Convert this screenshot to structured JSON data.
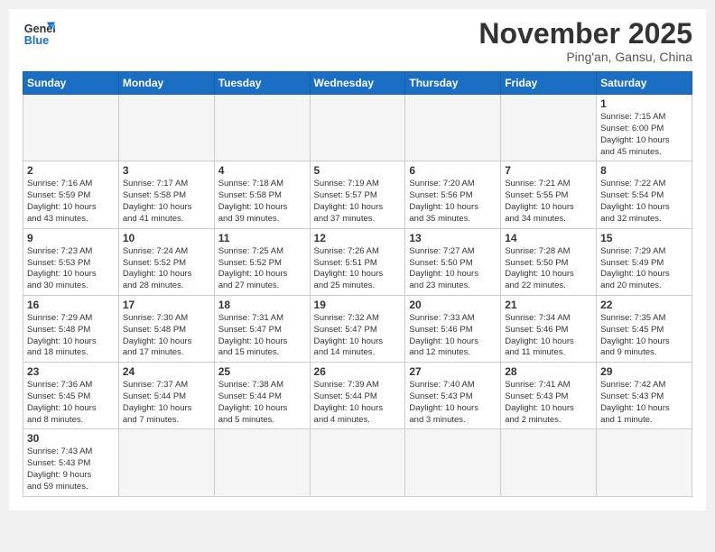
{
  "header": {
    "logo_line1": "General",
    "logo_line2": "Blue",
    "month_title": "November 2025",
    "location": "Ping'an, Gansu, China"
  },
  "weekdays": [
    "Sunday",
    "Monday",
    "Tuesday",
    "Wednesday",
    "Thursday",
    "Friday",
    "Saturday"
  ],
  "weeks": [
    [
      {
        "day": "",
        "info": ""
      },
      {
        "day": "",
        "info": ""
      },
      {
        "day": "",
        "info": ""
      },
      {
        "day": "",
        "info": ""
      },
      {
        "day": "",
        "info": ""
      },
      {
        "day": "",
        "info": ""
      },
      {
        "day": "1",
        "info": "Sunrise: 7:15 AM\nSunset: 6:00 PM\nDaylight: 10 hours\nand 45 minutes."
      }
    ],
    [
      {
        "day": "2",
        "info": "Sunrise: 7:16 AM\nSunset: 5:59 PM\nDaylight: 10 hours\nand 43 minutes."
      },
      {
        "day": "3",
        "info": "Sunrise: 7:17 AM\nSunset: 5:58 PM\nDaylight: 10 hours\nand 41 minutes."
      },
      {
        "day": "4",
        "info": "Sunrise: 7:18 AM\nSunset: 5:58 PM\nDaylight: 10 hours\nand 39 minutes."
      },
      {
        "day": "5",
        "info": "Sunrise: 7:19 AM\nSunset: 5:57 PM\nDaylight: 10 hours\nand 37 minutes."
      },
      {
        "day": "6",
        "info": "Sunrise: 7:20 AM\nSunset: 5:56 PM\nDaylight: 10 hours\nand 35 minutes."
      },
      {
        "day": "7",
        "info": "Sunrise: 7:21 AM\nSunset: 5:55 PM\nDaylight: 10 hours\nand 34 minutes."
      },
      {
        "day": "8",
        "info": "Sunrise: 7:22 AM\nSunset: 5:54 PM\nDaylight: 10 hours\nand 32 minutes."
      }
    ],
    [
      {
        "day": "9",
        "info": "Sunrise: 7:23 AM\nSunset: 5:53 PM\nDaylight: 10 hours\nand 30 minutes."
      },
      {
        "day": "10",
        "info": "Sunrise: 7:24 AM\nSunset: 5:52 PM\nDaylight: 10 hours\nand 28 minutes."
      },
      {
        "day": "11",
        "info": "Sunrise: 7:25 AM\nSunset: 5:52 PM\nDaylight: 10 hours\nand 27 minutes."
      },
      {
        "day": "12",
        "info": "Sunrise: 7:26 AM\nSunset: 5:51 PM\nDaylight: 10 hours\nand 25 minutes."
      },
      {
        "day": "13",
        "info": "Sunrise: 7:27 AM\nSunset: 5:50 PM\nDaylight: 10 hours\nand 23 minutes."
      },
      {
        "day": "14",
        "info": "Sunrise: 7:28 AM\nSunset: 5:50 PM\nDaylight: 10 hours\nand 22 minutes."
      },
      {
        "day": "15",
        "info": "Sunrise: 7:29 AM\nSunset: 5:49 PM\nDaylight: 10 hours\nand 20 minutes."
      }
    ],
    [
      {
        "day": "16",
        "info": "Sunrise: 7:29 AM\nSunset: 5:48 PM\nDaylight: 10 hours\nand 18 minutes."
      },
      {
        "day": "17",
        "info": "Sunrise: 7:30 AM\nSunset: 5:48 PM\nDaylight: 10 hours\nand 17 minutes."
      },
      {
        "day": "18",
        "info": "Sunrise: 7:31 AM\nSunset: 5:47 PM\nDaylight: 10 hours\nand 15 minutes."
      },
      {
        "day": "19",
        "info": "Sunrise: 7:32 AM\nSunset: 5:47 PM\nDaylight: 10 hours\nand 14 minutes."
      },
      {
        "day": "20",
        "info": "Sunrise: 7:33 AM\nSunset: 5:46 PM\nDaylight: 10 hours\nand 12 minutes."
      },
      {
        "day": "21",
        "info": "Sunrise: 7:34 AM\nSunset: 5:46 PM\nDaylight: 10 hours\nand 11 minutes."
      },
      {
        "day": "22",
        "info": "Sunrise: 7:35 AM\nSunset: 5:45 PM\nDaylight: 10 hours\nand 9 minutes."
      }
    ],
    [
      {
        "day": "23",
        "info": "Sunrise: 7:36 AM\nSunset: 5:45 PM\nDaylight: 10 hours\nand 8 minutes."
      },
      {
        "day": "24",
        "info": "Sunrise: 7:37 AM\nSunset: 5:44 PM\nDaylight: 10 hours\nand 7 minutes."
      },
      {
        "day": "25",
        "info": "Sunrise: 7:38 AM\nSunset: 5:44 PM\nDaylight: 10 hours\nand 5 minutes."
      },
      {
        "day": "26",
        "info": "Sunrise: 7:39 AM\nSunset: 5:44 PM\nDaylight: 10 hours\nand 4 minutes."
      },
      {
        "day": "27",
        "info": "Sunrise: 7:40 AM\nSunset: 5:43 PM\nDaylight: 10 hours\nand 3 minutes."
      },
      {
        "day": "28",
        "info": "Sunrise: 7:41 AM\nSunset: 5:43 PM\nDaylight: 10 hours\nand 2 minutes."
      },
      {
        "day": "29",
        "info": "Sunrise: 7:42 AM\nSunset: 5:43 PM\nDaylight: 10 hours\nand 1 minute."
      }
    ],
    [
      {
        "day": "30",
        "info": "Sunrise: 7:43 AM\nSunset: 5:43 PM\nDaylight: 9 hours\nand 59 minutes."
      },
      {
        "day": "",
        "info": ""
      },
      {
        "day": "",
        "info": ""
      },
      {
        "day": "",
        "info": ""
      },
      {
        "day": "",
        "info": ""
      },
      {
        "day": "",
        "info": ""
      },
      {
        "day": "",
        "info": ""
      }
    ]
  ]
}
